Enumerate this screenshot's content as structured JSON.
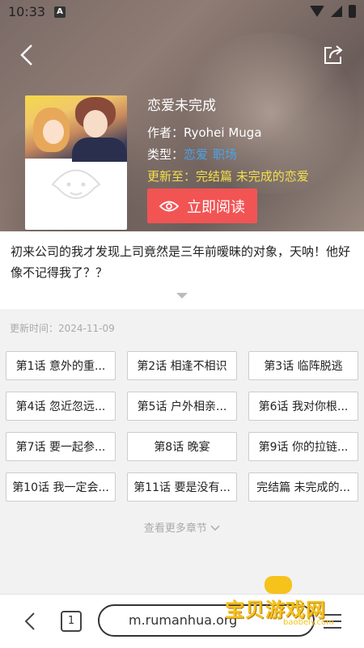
{
  "status_bar": {
    "time": "10:33",
    "notification_icon": "A"
  },
  "header": {
    "back_icon": "chevron-left-icon",
    "share_icon": "share-icon"
  },
  "comic": {
    "title": "恋爱未完成",
    "author_label": "作者：",
    "author": "Ryohei Muga",
    "genre_label": "类型：",
    "genres": [
      "恋爱",
      "职场"
    ],
    "update_label": "更新至：",
    "latest": "完结篇 未完成的恋爱",
    "read_button": "立即阅读",
    "description": "初来公司的我才发现上司竟然是三年前暧昧的对象，天呐！他好像不记得我了？？"
  },
  "chapter_list": {
    "update_time": "更新时间：2024-11-09",
    "chapters": [
      "第1话 意外的重...",
      "第2话 相逢不相识",
      "第3话 临阵脱逃",
      "第4话 忽近忽远...",
      "第5话 户外相亲...",
      "第6话 我对你根...",
      "第7话 要一起参...",
      "第8话 晚宴",
      "第9话 你的拉链...",
      "第10话 我一定会...",
      "第11话 要是没有...",
      "完结篇 未完成的..."
    ],
    "more": "查看更多章节"
  },
  "browser_bar": {
    "tab_count": "1",
    "url": "m.rumanhua.org"
  },
  "watermark": {
    "text": "宝贝游戏网",
    "sub": "baobeiy.com"
  },
  "colors": {
    "accent": "#f25454",
    "tag": "#4aa3e8",
    "update": "#f2e04a"
  }
}
